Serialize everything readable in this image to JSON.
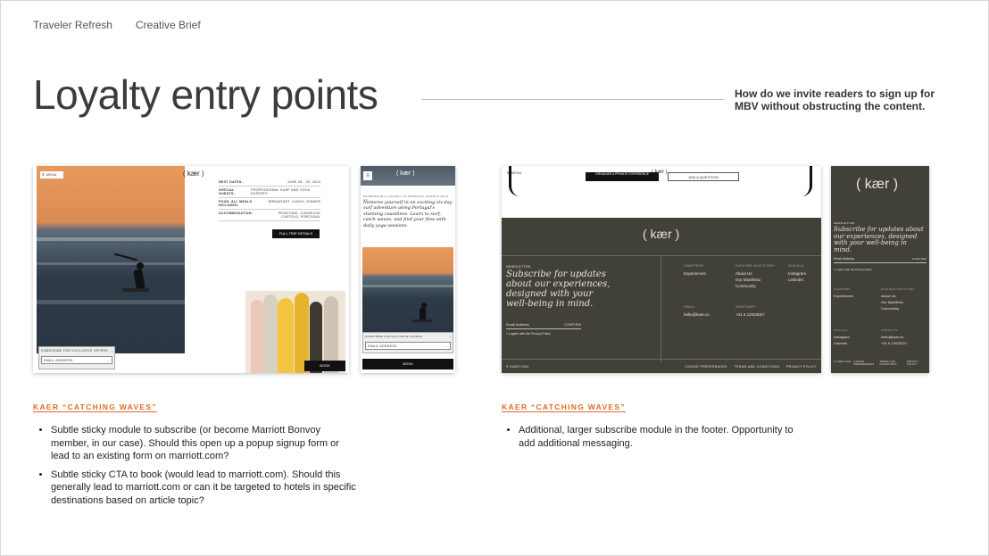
{
  "header": {
    "left": "Traveler Refresh",
    "right": "Creative Brief"
  },
  "title": "Loyalty entry points",
  "question": "How do we invite readers to sign up for MBV without obstructing the content.",
  "left_section": {
    "label": "KAER “CATCHING WAVES”",
    "bullets": [
      "Subtle sticky module to subscribe (or become Marriott Bonvoy member, in our case). Should this open up a popup signup form or lead to an existing form on marriott.com?",
      "Subtle sticky CTA to book (would lead to marriott.com). Should this generally lead to marriott.com or can it be targeted to hotels in specific destinations based on article topic?"
    ],
    "desktop": {
      "menu": "MENU",
      "logo": "( kær )",
      "details": [
        {
          "label": "NEXT DATES:",
          "value": "JUNE 28 - 30, 2024"
        },
        {
          "label": "SPECIAL GUESTS:",
          "value": "PROFESSIONAL SURF AND YOGA EXPERTS"
        },
        {
          "label": "FOOD, ALL MEALS INCLUDED:",
          "value": "BREAKFAST, LUNCH, DINNER"
        },
        {
          "label": "ACCOMMODATION:",
          "value": "PENICHINE, CONSELHO CASTELO, PORTUGAL"
        }
      ],
      "cta": "FULL TRIP DETAILS",
      "subscribe_label": "SUBSCRIBE FOR EXCLUSIVE OFFERS",
      "email_placeholder": "EMAIL ADDRESS",
      "book": "BOOK"
    },
    "mobile": {
      "logo": "( kær )",
      "kicker": "EXPERIENCE'S JOURNEY OF PERSONAL GROWTH WITH US",
      "intro": "Immerse yourself in an exciting six-day surf adventure along Portugal's stunning coastlines. Learn to surf, catch waves, and find your flow with daily yoga sessions.",
      "subscribe_label": "SUBSCRIBE FOR EXCLUSIVE OFFERS",
      "email_placeholder": "EMAIL ADDRESS",
      "book": "BOOK"
    }
  },
  "right_section": {
    "label": "KAER “CATCHING WAVES”",
    "bullets": [
      "Additional, larger subscribe module in the footer. Opportunity to add additional messaging."
    ],
    "desktop": {
      "menu": "MENU",
      "btn_private": "ORGANIZE A PRIVATE EXPERIENCE",
      "btn_question": "ASK A QUESTION",
      "logo_small": "( kær )",
      "logo": "( kær )",
      "newsletter_label": "NEWSLETTER",
      "newsletter_heading": "Subscribe for updates about our experiences, designed with your well-being in mind.",
      "email_placeholder": "Email Address",
      "confirm": "CONFIRM",
      "agree": "I agree with the Privacy Policy",
      "cols": [
        {
          "head": "CHAPTERS",
          "items": [
            "Experiences"
          ]
        },
        {
          "head": "EXPLORE OUR STORY",
          "items": [
            "About Us",
            "Our Manifesto",
            "Community"
          ]
        },
        {
          "head": "SOCIALS",
          "items": [
            "Instagram",
            "LinkedIn"
          ]
        }
      ],
      "email_head": "EMAIL",
      "email": "hello@kaer.co",
      "whatsapp_head": "WHATSAPP",
      "phone": "+31 6 12023027",
      "copyright": "© KAER 2024",
      "legal": [
        "COOKIE PREFERENCES",
        "TERMS AND CONDITIONS",
        "PRIVACY POLICY"
      ]
    },
    "mobile": {
      "logo": "( kær )",
      "newsletter_label": "NEWSLETTER",
      "heading": "Subscribe for updates about our experiences, designed with your well-being in mind.",
      "email_placeholder": "Email Address",
      "confirm": "CONFIRM",
      "agree": "I agree with the Privacy Policy",
      "chapters_head": "CHAPTERS",
      "chapters": [
        "Experiences"
      ],
      "explore_head": "EXPLORE OUR STORY",
      "explore": [
        "About Us",
        "Our Manifesto",
        "Community"
      ],
      "socials_head": "SOCIALS",
      "socials": [
        "Instagram",
        "LinkedIn"
      ],
      "contacts_head": "CONTACTS",
      "contacts": [
        "hello@kaer.co",
        "+31 6 12023027"
      ],
      "legal": [
        "© KAER 2024",
        "COOKIE PREFERENCES",
        "TERMS AND CONDITIONS",
        "PRIVACY POLICY"
      ]
    }
  },
  "colors": {
    "accent": "#e06a2a",
    "footer": "#414138",
    "title": "#3b3b3b"
  }
}
